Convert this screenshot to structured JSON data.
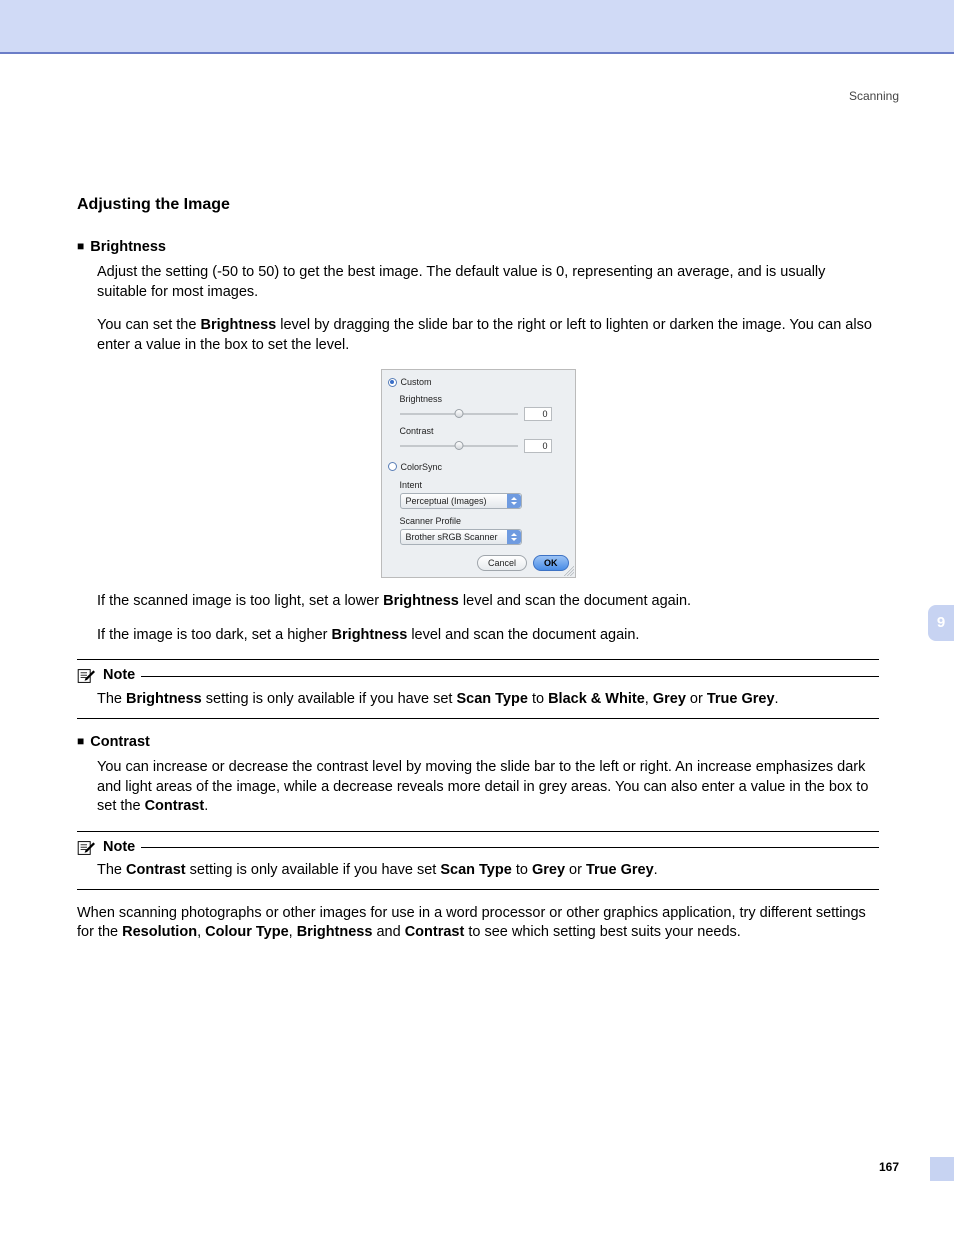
{
  "header": {
    "section": "Scanning"
  },
  "title": "Adjusting the Image",
  "s1": {
    "head": "Brightness",
    "p1a": "Adjust the setting (-50 to 50) to get the best image. The default value is 0, representing an average, and is usually suitable for most images.",
    "p2a": "You can set the ",
    "p2b": "Brightness",
    "p2c": " level by dragging the slide bar to the right or left to lighten or darken the image. You can also enter a value in the box to set the level.",
    "p3a": "If the scanned image is too light, set a lower ",
    "p3b": "Brightness",
    "p3c": " level and scan the document again.",
    "p4a": "If the image is too dark, set a higher ",
    "p4b": "Brightness",
    "p4c": " level and scan the document again."
  },
  "dialog": {
    "opt_custom": "Custom",
    "lbl_brightness": "Brightness",
    "val_brightness": "0",
    "lbl_contrast": "Contrast",
    "val_contrast": "0",
    "opt_colorsync": "ColorSync",
    "lbl_intent": "Intent",
    "dd_intent": "Perceptual (Images)",
    "lbl_profile": "Scanner Profile",
    "dd_profile": "Brother sRGB Scanner",
    "btn_cancel": "Cancel",
    "btn_ok": "OK"
  },
  "note1": {
    "label": "Note",
    "a": "The ",
    "b": "Brightness",
    "c": " setting is only available if you have set ",
    "d": "Scan Type",
    "e": " to ",
    "f": "Black & White",
    "g": ", ",
    "h": "Grey",
    "i": " or ",
    "j": "True Grey",
    "k": "."
  },
  "s2": {
    "head": "Contrast",
    "p1a": "You can increase or decrease the contrast level by moving the slide bar to the left or right. An increase emphasizes dark and light areas of the image, while a decrease reveals more detail in grey areas. You can also enter a value in the box to set the ",
    "p1b": "Contrast",
    "p1c": "."
  },
  "note2": {
    "label": "Note",
    "a": "The ",
    "b": "Contrast",
    "c": " setting is only available if you have set ",
    "d": "Scan Type",
    "e": " to ",
    "f": "Grey",
    "g": " or ",
    "h": "True Grey",
    "i": "."
  },
  "closing": {
    "a": "When scanning photographs or other images for use in a word processor or other graphics application, try different settings for the ",
    "b": "Resolution",
    "c": ", ",
    "d": "Colour Type",
    "e": ", ",
    "f": "Brightness",
    "g": " and ",
    "h": "Contrast",
    "i": " to see which setting best suits your needs."
  },
  "chapter_tab": "9",
  "page_number": "167"
}
